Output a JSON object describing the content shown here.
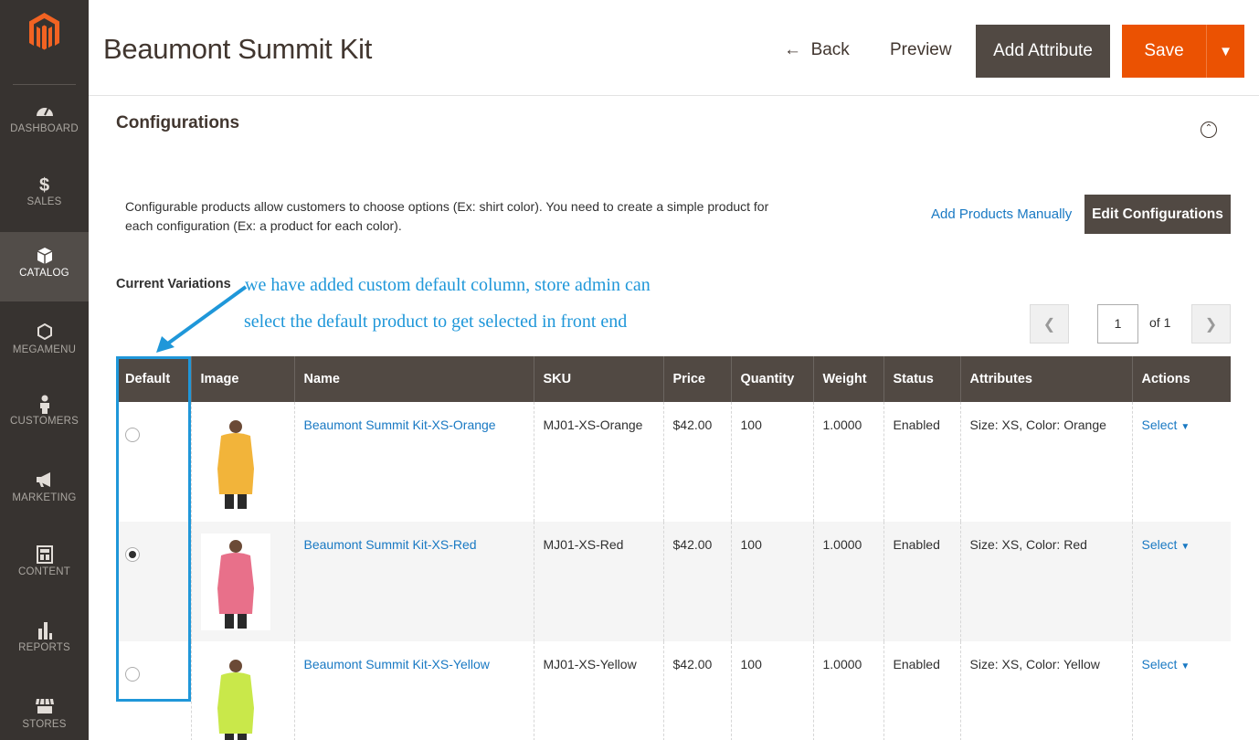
{
  "header": {
    "title": "Beaumont Summit Kit",
    "back_label": "Back",
    "preview_label": "Preview",
    "add_attribute_label": "Add Attribute",
    "save_label": "Save"
  },
  "sidebar": {
    "items": [
      {
        "label": "DASHBOARD",
        "icon": "dashboard-icon"
      },
      {
        "label": "SALES",
        "icon": "dollar-icon"
      },
      {
        "label": "CATALOG",
        "icon": "box-icon"
      },
      {
        "label": "MEGAMENU",
        "icon": "hexagon-icon"
      },
      {
        "label": "CUSTOMERS",
        "icon": "person-icon"
      },
      {
        "label": "MARKETING",
        "icon": "megaphone-icon"
      },
      {
        "label": "CONTENT",
        "icon": "content-icon"
      },
      {
        "label": "REPORTS",
        "icon": "bar-chart-icon"
      },
      {
        "label": "STORES",
        "icon": "store-icon"
      }
    ]
  },
  "section": {
    "title": "Configurations",
    "description": "Configurable products allow customers to choose options (Ex: shirt color). You need to create a simple product for each configuration (Ex: a product for each color).",
    "add_manual_label": "Add Products Manually",
    "edit_config_label": "Edit Configurations",
    "current_variations_label": "Current Variations"
  },
  "annotation": {
    "line1": "we have added custom default column, store admin can",
    "line2": "select the default product to get selected in front end"
  },
  "pager": {
    "page": "1",
    "of_label": "of 1"
  },
  "table": {
    "columns": [
      "Default",
      "Image",
      "Name",
      "SKU",
      "Price",
      "Quantity",
      "Weight",
      "Status",
      "Attributes",
      "Actions"
    ],
    "rows": [
      {
        "name": "Beaumont Summit Kit-XS-Orange",
        "sku": "MJ01-XS-Orange",
        "price": "$42.00",
        "qty": "100",
        "weight": "1.0000",
        "status": "Enabled",
        "attributes": "Size: XS, Color: Orange",
        "action": "Select",
        "default": false,
        "color": "#f2b43a"
      },
      {
        "name": "Beaumont Summit Kit-XS-Red",
        "sku": "MJ01-XS-Red",
        "price": "$42.00",
        "qty": "100",
        "weight": "1.0000",
        "status": "Enabled",
        "attributes": "Size: XS, Color: Red",
        "action": "Select",
        "default": true,
        "color": "#e8708a"
      },
      {
        "name": "Beaumont Summit Kit-XS-Yellow",
        "sku": "MJ01-XS-Yellow",
        "price": "$42.00",
        "qty": "100",
        "weight": "1.0000",
        "status": "Enabled",
        "attributes": "Size: XS, Color: Yellow",
        "action": "Select",
        "default": false,
        "color": "#c9e84a"
      }
    ]
  },
  "colors": {
    "accent": "#eb5202",
    "dark": "#514943",
    "sidebar": "#373330",
    "link": "#1979c3",
    "annotation": "#1f97d9"
  }
}
